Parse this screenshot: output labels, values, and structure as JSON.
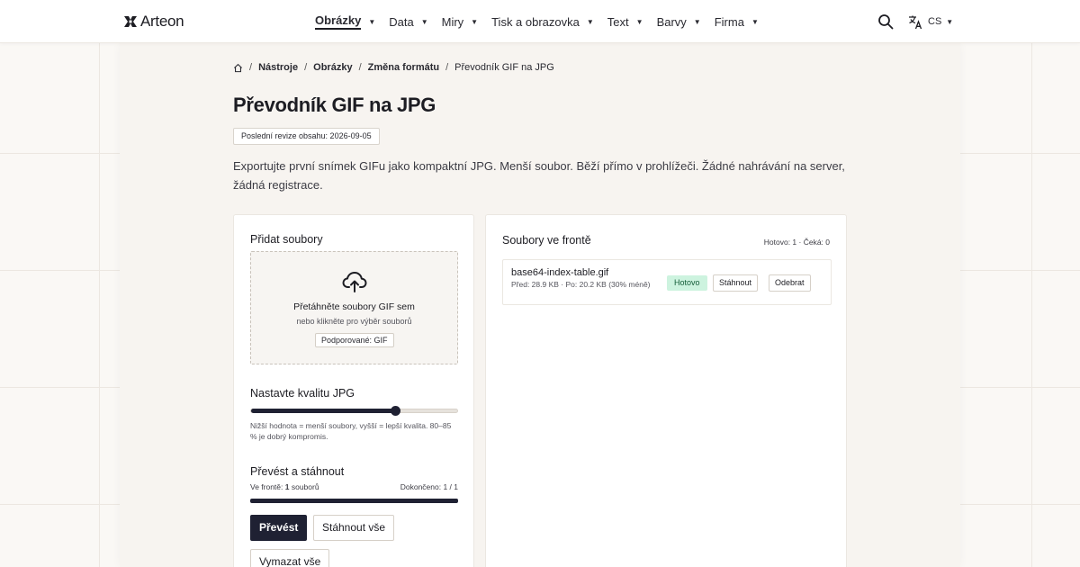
{
  "brand": {
    "name": "Arteon"
  },
  "nav": {
    "items": [
      {
        "label": "Obrázky",
        "active": true
      },
      {
        "label": "Data"
      },
      {
        "label": "Miry"
      },
      {
        "label": "Tisk a obrazovka"
      },
      {
        "label": "Text"
      },
      {
        "label": "Barvy"
      },
      {
        "label": "Firma"
      }
    ],
    "language": "CS"
  },
  "breadcrumb": [
    "Nástroje",
    "Obrázky",
    "Změna formátu",
    "Převodník GIF na JPG"
  ],
  "page": {
    "title": "Převodník GIF na JPG",
    "revision": "Poslední revize obsahu: 2026-09-05",
    "intro": "Exportujte první snímek GIFu jako kompaktní JPG. Menší soubor. Běží přímo v prohlížeči. Žádné nahrávání na server, žádná registrace."
  },
  "upload": {
    "title": "Přidat soubory",
    "drop_text": "Přetáhněte soubory GIF sem",
    "drop_sub": "nebo klikněte pro výběr souborů",
    "supported": "Podporované: GIF"
  },
  "quality": {
    "title": "Nastavte kvalitu JPG",
    "value": 0.7,
    "hint": "Nižší hodnota = menší soubory, vyšší = lepší kvalita. 80–85 % je dobrý kompromis."
  },
  "convert": {
    "title": "Převést a stáhnout",
    "queue_prefix": "Ve frontě: ",
    "queue_count": "1",
    "queue_suffix": " souborů",
    "done_text": "Dokončeno: 1 / 1",
    "progress": 1.0,
    "convert_label": "Převést",
    "download_all_label": "Stáhnout vše",
    "clear_all_label": "Vymazat vše"
  },
  "queue": {
    "title": "Soubory ve frontě",
    "summary": "Hotovo: 1 · Čeká: 0",
    "files": [
      {
        "name": "base64-index-table.gif",
        "meta": "Před: 28.9 KB · Po: 20.2 KB (30% méně)",
        "status": "Hotovo",
        "download_label": "Stáhnout",
        "remove_label": "Odebrat"
      }
    ]
  },
  "colors": {
    "accent": "#1f2133",
    "status_done_bg": "#cdf3df",
    "page_bg": "#faf8f5"
  },
  "icons": {
    "logo": "arteon-logo-icon",
    "search": "search-icon",
    "language": "translate-icon",
    "home": "home-icon",
    "upload": "cloud-upload-icon"
  }
}
